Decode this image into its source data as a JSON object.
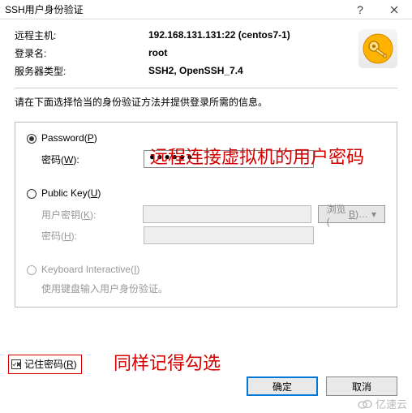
{
  "titlebar": {
    "title": "SSH用户身份验证"
  },
  "info": {
    "remote_host_label": "远程主机:",
    "remote_host_value": "192.168.131.131:22 (centos7-1)",
    "login_label": "登录名:",
    "login_value": "root",
    "server_type_label": "服务器类型:",
    "server_type_value": "SSH2, OpenSSH_7.4"
  },
  "instruction": "请在下面选择恰当的身份验证方法并提供登录所需的信息。",
  "password_section": {
    "radio_label": "Password(P)",
    "field_label": "密码(W):",
    "value_masked": "●●●●●●"
  },
  "publickey_section": {
    "radio_label": "Public Key(U)",
    "userkey_label": "用户密钥(K):",
    "password_label": "密码(H):",
    "browse_label": "浏览(B)…"
  },
  "ki_section": {
    "radio_label": "Keyboard Interactive(I)",
    "subtext": "使用键盘输入用户身份验证。"
  },
  "remember": {
    "label": "记住密码(R)"
  },
  "buttons": {
    "ok": "确定",
    "cancel": "取消"
  },
  "annotations": {
    "a1": "远程连接虚拟机的用户密码",
    "a2": "同样记得勾选"
  },
  "watermark": "亿速云"
}
